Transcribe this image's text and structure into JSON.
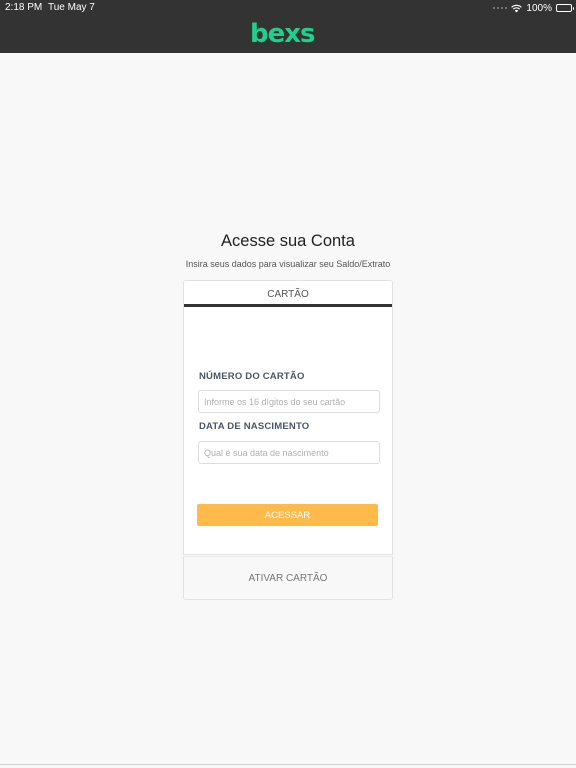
{
  "status_bar": {
    "time": "2:18 PM",
    "date": "Tue May 7",
    "battery": "100%"
  },
  "brand": {
    "logo_text": "bexs",
    "logo_color": "#1fd18e",
    "header_color": "#333333"
  },
  "login": {
    "title": "Acesse sua Conta",
    "subtitle": "Insira seus dados para visualizar seu Saldo/Extrato",
    "tab_label": "CARTÃO",
    "card_number_label": "NÚMERO DO CARTÃO",
    "card_number_placeholder": "Informe os 16 dígitos do seu cartão",
    "card_number_value": "",
    "birth_date_label": "DATA DE NASCIMENTO",
    "birth_date_placeholder": "Qual é sua data de nascimento",
    "birth_date_value": "",
    "submit_label": "ACESSAR",
    "submit_color": "#ffba4a",
    "activate_label": "ATIVAR CARTÃO"
  },
  "icons": [
    "signal-dots-icon",
    "wifi-icon",
    "battery-icon"
  ]
}
